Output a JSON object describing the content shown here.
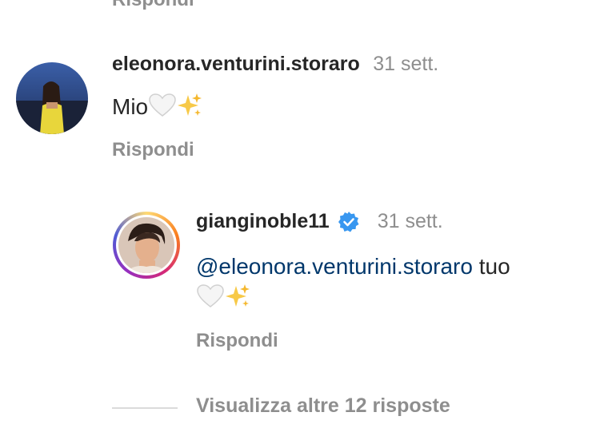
{
  "top_cut": {
    "reply_label": "Rispondi"
  },
  "comment": {
    "username": "eleonora.venturini.storaro",
    "time": "31 sett.",
    "text": "Mio",
    "emojis": [
      "white-heart-icon",
      "sparkles-icon"
    ],
    "reply_label": "Rispondi"
  },
  "reply": {
    "username": "gianginoble11",
    "verified": true,
    "time": "31 sett.",
    "mention": "@eleonora.venturini.storaro",
    "text": " tuo",
    "emojis": [
      "white-heart-icon",
      "sparkles-icon"
    ],
    "reply_label": "Rispondi"
  },
  "more_replies": {
    "label": "Visualizza altre 12 risposte"
  },
  "colors": {
    "verified": "#3897f0",
    "secondary_text": "#8e8e8e",
    "mention": "#00376b"
  }
}
